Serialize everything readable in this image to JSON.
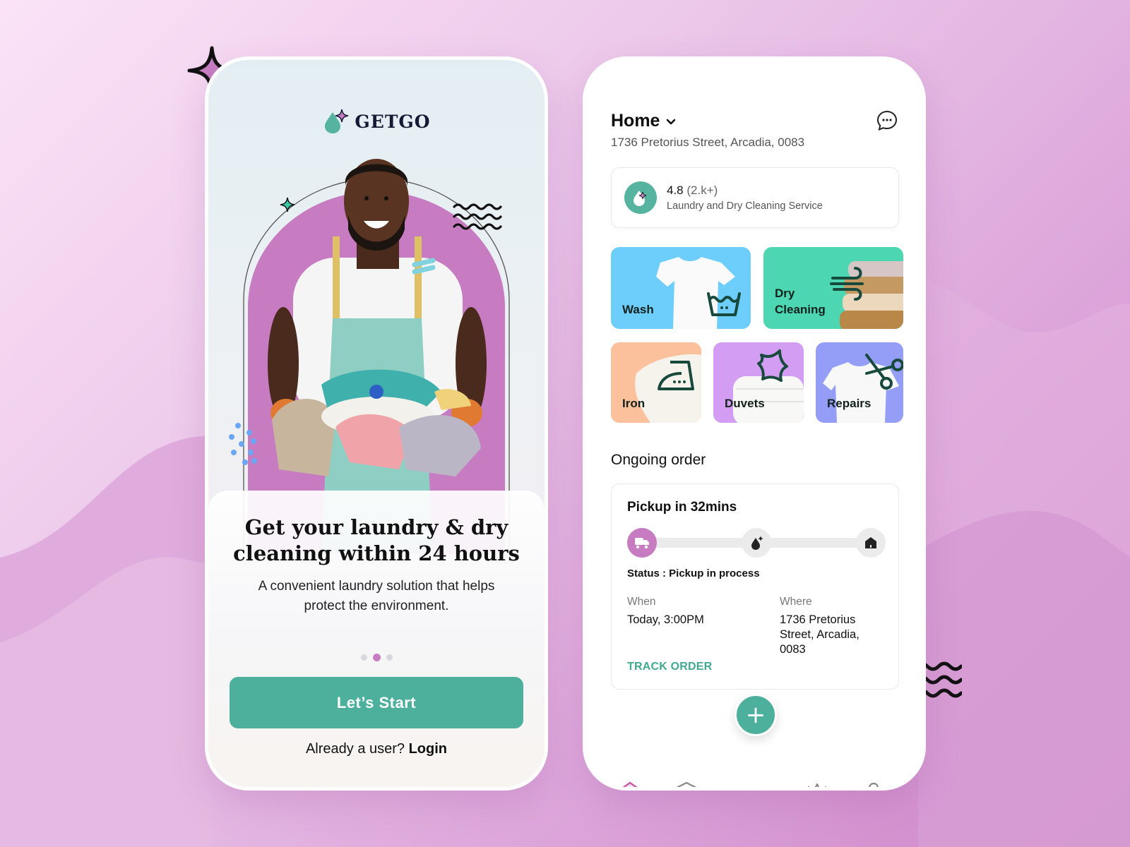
{
  "colors": {
    "brand_teal": "#4db09d",
    "accent_purple": "#c77bc1",
    "text_dark": "#111111",
    "tile_wash": "#6dcdfb",
    "tile_dry": "#4dd6b2",
    "tile_iron": "#fbc19c",
    "tile_duvets": "#d49df4",
    "tile_repairs": "#949ef7"
  },
  "onboarding": {
    "brand_name": "GETGO",
    "headline": "Get your laundry & dry cleaning within 24 hours",
    "subline": "A convenient laundry solution that helps protect the environment.",
    "pager": {
      "total": 3,
      "active_index": 1
    },
    "start_button": "Let’s Start",
    "login_prompt": "Already a user?",
    "login_link": "Login"
  },
  "home": {
    "location_title": "Home",
    "address": "1736 Pretorius Street, Arcadia, 0083",
    "rating": {
      "score": "4.8",
      "count": "(2.k+)",
      "description": "Laundry and Dry Cleaning Service"
    },
    "services": [
      {
        "label": "Wash",
        "icon": "wash-basin-icon"
      },
      {
        "label": "Dry Cleaning",
        "icon": "wind-icon"
      },
      {
        "label": "Iron",
        "icon": "iron-icon"
      },
      {
        "label": "Duvets",
        "icon": "pillow-icon"
      },
      {
        "label": "Repairs",
        "icon": "scissors-icon"
      }
    ],
    "ongoing_title": "Ongoing order",
    "order": {
      "pickup_title": "Pickup in 32mins",
      "steps": [
        {
          "icon": "truck-icon",
          "state": "active"
        },
        {
          "icon": "drop-sparkle-icon",
          "state": "pending"
        },
        {
          "icon": "home-icon",
          "state": "pending"
        }
      ],
      "status": "Status : Pickup in process",
      "when_label": "When",
      "when_value": "Today, 3:00PM",
      "where_label": "Where",
      "where_value": "1736 Pretorius Street, Arcadia, 0083",
      "track_link": "TRACK ORDER"
    },
    "tabbar": {
      "items": [
        {
          "icon": "home-icon",
          "active": true
        },
        {
          "icon": "box-icon",
          "active": false
        },
        {
          "icon": "crown-icon",
          "active": false
        },
        {
          "icon": "user-icon",
          "active": false
        }
      ],
      "fab_label": "+"
    }
  }
}
